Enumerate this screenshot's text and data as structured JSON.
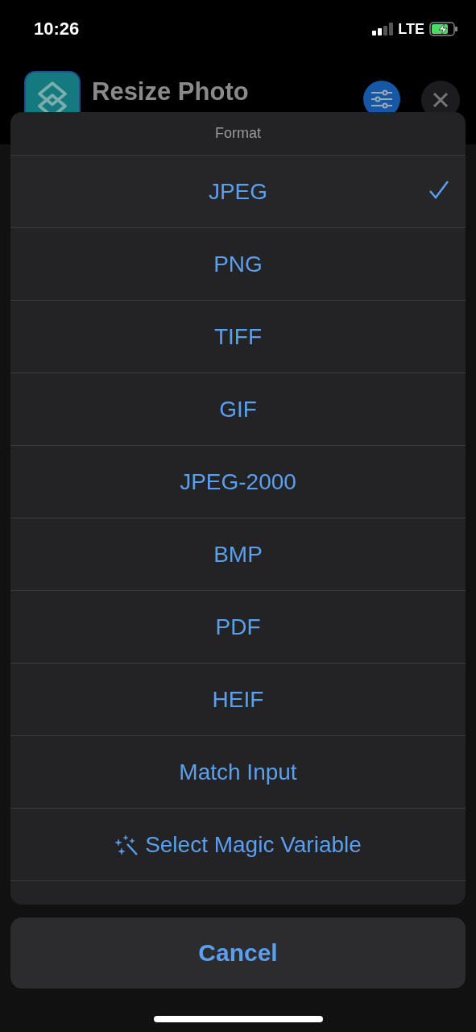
{
  "status_bar": {
    "time": "10:26",
    "network": "LTE"
  },
  "header": {
    "title": "Resize Photo"
  },
  "sheet": {
    "title": "Format",
    "options": [
      {
        "label": "JPEG",
        "kind": "option",
        "selected": true
      },
      {
        "label": "PNG",
        "kind": "option",
        "selected": false
      },
      {
        "label": "TIFF",
        "kind": "option",
        "selected": false
      },
      {
        "label": "GIF",
        "kind": "option",
        "selected": false
      },
      {
        "label": "JPEG-2000",
        "kind": "option",
        "selected": false
      },
      {
        "label": "BMP",
        "kind": "option",
        "selected": false
      },
      {
        "label": "PDF",
        "kind": "option",
        "selected": false
      },
      {
        "label": "HEIF",
        "kind": "option",
        "selected": false
      },
      {
        "label": "Match Input",
        "kind": "option",
        "selected": false
      },
      {
        "label": "Select Magic Variable",
        "kind": "magic",
        "selected": false
      }
    ]
  },
  "cancel": "Cancel"
}
